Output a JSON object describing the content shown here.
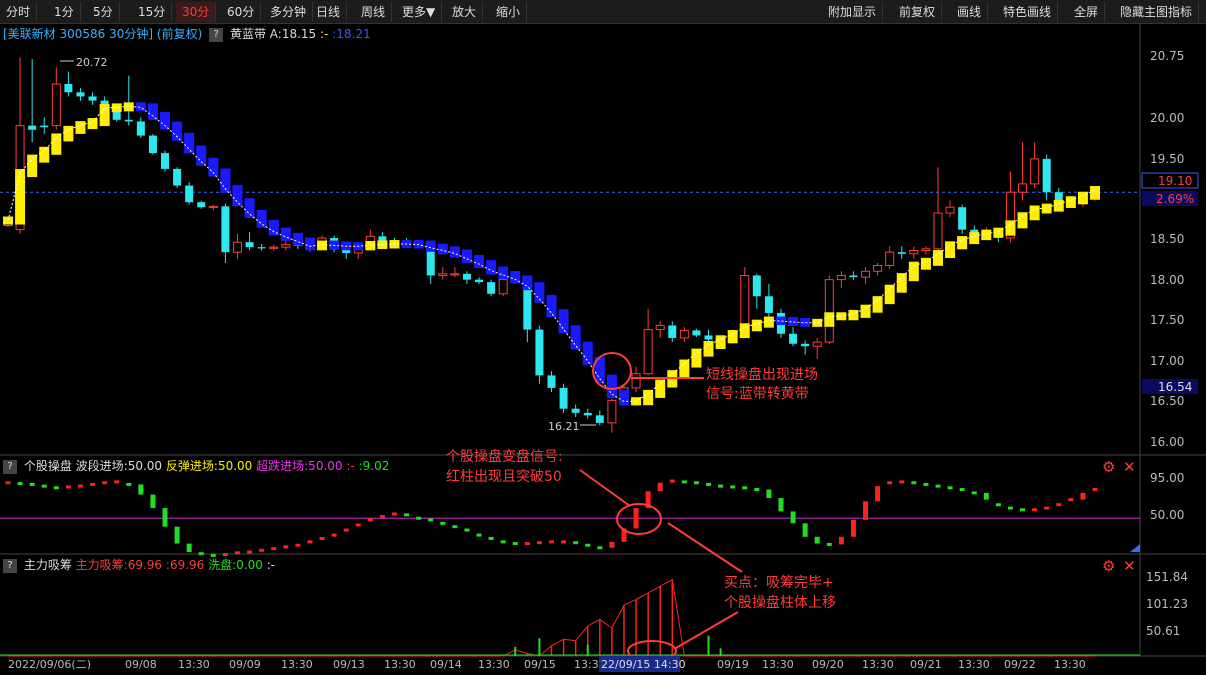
{
  "toolbar": {
    "periods": [
      "分时",
      "1分",
      "5分",
      "15分",
      "30分",
      "60分",
      "多分钟",
      "日线",
      "周线",
      "更多▼",
      "放大",
      "缩小"
    ],
    "active": "30分",
    "right": [
      "附加显示",
      "前复权",
      "画线",
      "特色画线",
      "全屏",
      "隐藏主图指标"
    ]
  },
  "header": {
    "stock": "[美联新材 300586 30分钟]",
    "adjust": "(前复权)",
    "q": "?",
    "indicator": "黄蓝带",
    "a_label": "A:18.15",
    "sep": ":-",
    "value2": ":18.21"
  },
  "main_axis": {
    "ticks": [
      "20.75",
      "20.00",
      "19.50",
      "19.00",
      "18.50",
      "18.00",
      "17.50",
      "17.00",
      "16.50",
      "16.00"
    ],
    "price_tag": "19.10",
    "pct_tag": "2.69%",
    "cursor_tag": "16.54"
  },
  "annotations": {
    "high": "20.72",
    "low": "16.21",
    "a1_line1": "短线操盘出现进场",
    "a1_line2": "信号:蓝带转黄带",
    "a2_line1": "个股操盘变盘信号:",
    "a2_line2": "红柱出现且突破50",
    "a3_line1": "买点：吸筹完毕+",
    "a3_line2": "个股操盘柱体上移"
  },
  "sub1": {
    "q": "?",
    "name": "个股操盘",
    "l1": "波段进场:50.00",
    "l2": "反弹进场:50.00",
    "l3": "超跌进场:50.00",
    "l4": ":-",
    "l5": ":9.02",
    "ticks": [
      "95.00",
      "50.00"
    ]
  },
  "sub2": {
    "q": "?",
    "name": "主力吸筹",
    "l1": "主力吸筹:69.96",
    "l2": ":69.96",
    "l3": "洗盘:0.00",
    "l4": ":-",
    "ticks": [
      "151.84",
      "101.23",
      "50.61"
    ]
  },
  "x_axis": {
    "labels": [
      "2022/09/06(二)",
      "09/08",
      "13:30",
      "09/09",
      "13:30",
      "09/13",
      "13:30",
      "09/14",
      "13:30",
      "09/15",
      "13:3",
      "22/09/15 14:30",
      "09/19",
      "13:30",
      "09/20",
      "13:30",
      "09/21",
      "13:30",
      "09/22",
      "13:30"
    ]
  },
  "colors": {
    "up": "#ff3b3b",
    "down": "#2ee6f0",
    "yellow_band": "#ffee00",
    "blue_band": "#1a1aff",
    "sub_green": "#22dd22",
    "sub_red": "#ff2020",
    "magenta": "#cc33cc",
    "annotation": "#ff3b3b"
  },
  "chart_data": {
    "type": "candlestick",
    "price_range": [
      15.98,
      21.0
    ],
    "candles_ohlc": [
      [
        18.7,
        18.8,
        18.68,
        18.76
      ],
      [
        18.65,
        20.72,
        18.6,
        19.9
      ],
      [
        19.9,
        20.7,
        19.7,
        19.85
      ],
      [
        19.9,
        20.0,
        19.8,
        19.88
      ],
      [
        19.9,
        20.6,
        19.85,
        20.4
      ],
      [
        20.4,
        20.55,
        20.25,
        20.3
      ],
      [
        20.3,
        20.35,
        20.2,
        20.25
      ],
      [
        20.25,
        20.3,
        20.15,
        20.2
      ],
      [
        20.2,
        20.25,
        20.05,
        20.1
      ],
      [
        20.1,
        20.15,
        19.95,
        19.97
      ],
      [
        19.97,
        20.5,
        19.9,
        19.95
      ],
      [
        19.95,
        20.0,
        19.75,
        19.78
      ],
      [
        19.78,
        19.8,
        19.55,
        19.57
      ],
      [
        19.57,
        19.6,
        19.35,
        19.38
      ],
      [
        19.38,
        19.4,
        19.15,
        19.18
      ],
      [
        19.18,
        19.22,
        18.95,
        18.98
      ],
      [
        18.98,
        19.0,
        18.9,
        18.92
      ],
      [
        18.92,
        18.95,
        18.88,
        18.93
      ],
      [
        18.93,
        18.96,
        18.25,
        18.38
      ],
      [
        18.38,
        18.6,
        18.3,
        18.5
      ],
      [
        18.5,
        18.62,
        18.4,
        18.44
      ],
      [
        18.44,
        18.48,
        18.4,
        18.43
      ],
      [
        18.43,
        18.47,
        18.4,
        18.44
      ],
      [
        18.44,
        18.52,
        18.4,
        18.47
      ],
      [
        18.47,
        18.52,
        18.42,
        18.46
      ],
      [
        18.46,
        18.5,
        18.38,
        18.48
      ],
      [
        18.48,
        18.58,
        18.46,
        18.55
      ],
      [
        18.55,
        18.58,
        18.38,
        18.41
      ],
      [
        18.41,
        18.45,
        18.3,
        18.37
      ],
      [
        18.37,
        18.45,
        18.3,
        18.42
      ],
      [
        18.42,
        18.65,
        18.4,
        18.57
      ],
      [
        18.57,
        18.62,
        18.5,
        18.52
      ],
      [
        18.52,
        18.55,
        18.48,
        18.5
      ],
      [
        18.5,
        18.55,
        18.45,
        18.48
      ],
      [
        18.48,
        18.52,
        18.45,
        18.5
      ],
      [
        18.48,
        18.5,
        18.0,
        18.1
      ],
      [
        18.1,
        18.2,
        18.05,
        18.12
      ],
      [
        18.12,
        18.2,
        18.08,
        18.12
      ],
      [
        18.12,
        18.15,
        18.0,
        18.05
      ],
      [
        18.05,
        18.08,
        18.0,
        18.02
      ],
      [
        18.02,
        18.05,
        17.85,
        17.88
      ],
      [
        17.88,
        18.1,
        17.85,
        18.05
      ],
      [
        18.05,
        18.15,
        18.0,
        18.08
      ],
      [
        18.08,
        18.1,
        17.3,
        17.45
      ],
      [
        17.45,
        17.5,
        16.8,
        16.9
      ],
      [
        16.9,
        16.95,
        16.7,
        16.75
      ],
      [
        16.75,
        16.8,
        16.45,
        16.5
      ],
      [
        16.5,
        16.55,
        16.4,
        16.45
      ],
      [
        16.45,
        16.5,
        16.38,
        16.42
      ],
      [
        16.42,
        16.48,
        16.3,
        16.33
      ],
      [
        16.33,
        16.62,
        16.21,
        16.6
      ],
      [
        16.6,
        16.78,
        16.55,
        16.75
      ],
      [
        16.75,
        17.0,
        16.7,
        16.92
      ],
      [
        16.92,
        17.7,
        16.9,
        17.45
      ],
      [
        17.45,
        17.55,
        17.35,
        17.5
      ],
      [
        17.5,
        17.55,
        17.3,
        17.35
      ],
      [
        17.35,
        17.48,
        17.3,
        17.44
      ],
      [
        17.44,
        17.46,
        17.36,
        17.38
      ],
      [
        17.38,
        17.45,
        17.3,
        17.33
      ],
      [
        17.33,
        17.38,
        17.28,
        17.3
      ],
      [
        17.3,
        17.45,
        17.28,
        17.42
      ],
      [
        17.42,
        18.2,
        17.4,
        18.1
      ],
      [
        18.1,
        18.12,
        17.7,
        17.85
      ],
      [
        17.85,
        18.0,
        17.6,
        17.65
      ],
      [
        17.65,
        17.7,
        17.35,
        17.4
      ],
      [
        17.4,
        17.48,
        17.25,
        17.28
      ],
      [
        17.28,
        17.32,
        17.15,
        17.25
      ],
      [
        17.25,
        17.35,
        17.1,
        17.3
      ],
      [
        17.3,
        18.1,
        17.28,
        18.05
      ],
      [
        18.05,
        18.15,
        17.95,
        18.1
      ],
      [
        18.1,
        18.15,
        18.05,
        18.08
      ],
      [
        18.08,
        18.2,
        18.0,
        18.15
      ],
      [
        18.15,
        18.25,
        18.1,
        18.22
      ],
      [
        18.22,
        18.45,
        18.18,
        18.38
      ],
      [
        18.38,
        18.45,
        18.3,
        18.36
      ],
      [
        18.36,
        18.45,
        18.3,
        18.4
      ],
      [
        18.4,
        18.45,
        18.35,
        18.42
      ],
      [
        18.42,
        19.4,
        18.4,
        18.85
      ],
      [
        18.85,
        19.0,
        18.8,
        18.92
      ],
      [
        18.92,
        18.95,
        18.6,
        18.65
      ],
      [
        18.65,
        18.7,
        18.55,
        18.6
      ],
      [
        18.6,
        18.68,
        18.55,
        18.62
      ],
      [
        18.62,
        18.65,
        18.5,
        18.55
      ],
      [
        18.55,
        19.35,
        18.5,
        19.1
      ],
      [
        19.1,
        19.7,
        19.0,
        19.2
      ],
      [
        19.2,
        19.7,
        19.15,
        19.5
      ],
      [
        19.5,
        19.55,
        19.0,
        19.1
      ],
      [
        19.1,
        19.15,
        18.95,
        19.0
      ],
      [
        19.0,
        19.05,
        18.92,
        18.96
      ],
      [
        18.96,
        19.1,
        18.92,
        19.05
      ],
      [
        19.05,
        19.12,
        19.0,
        19.1
      ]
    ],
    "sub1_levels": [
      95,
      50
    ],
    "sub2_levels": [
      151.84,
      101.23,
      50.61
    ]
  }
}
